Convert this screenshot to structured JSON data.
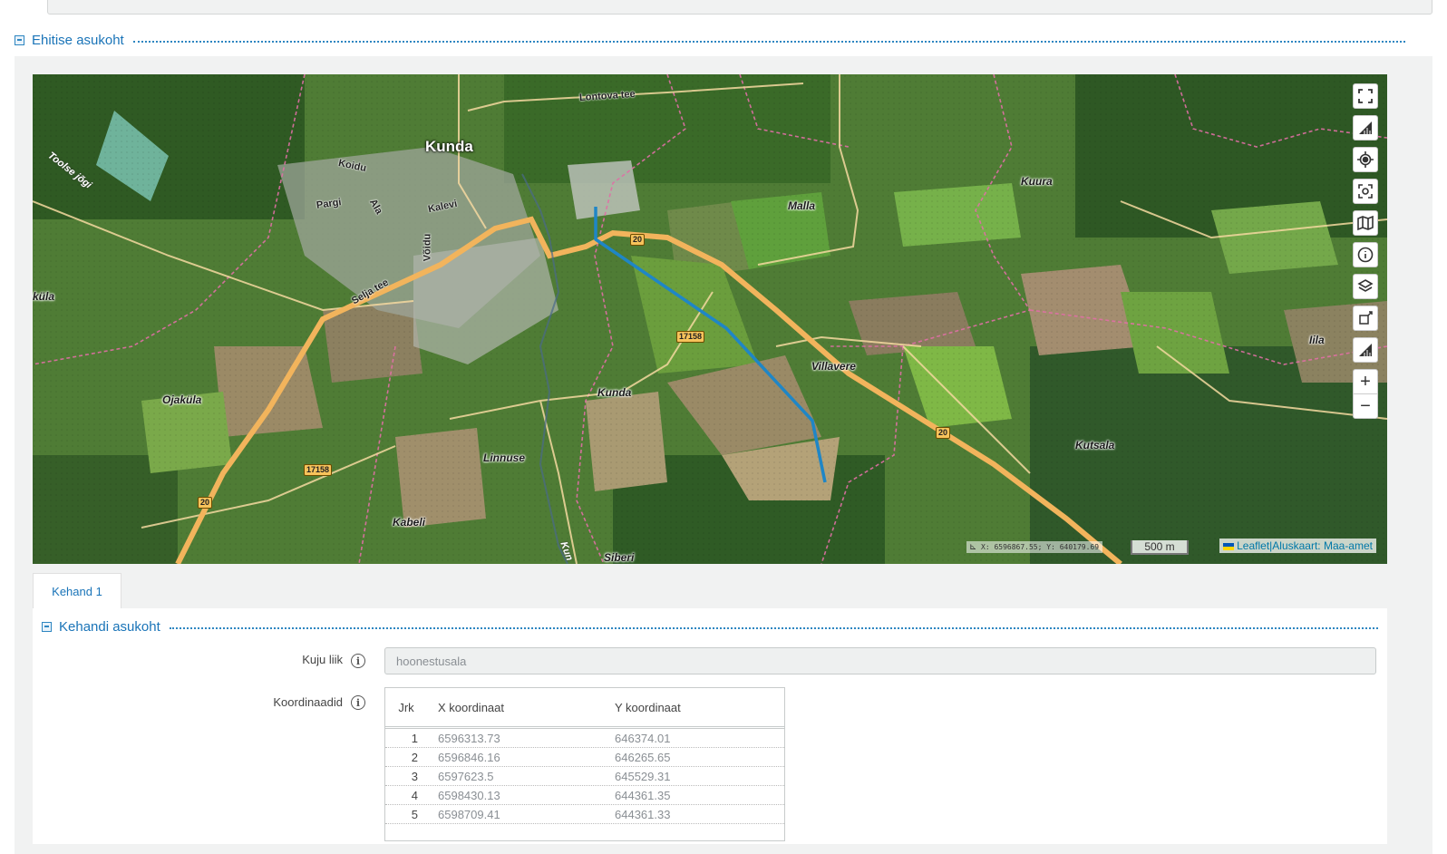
{
  "section": {
    "title": "Ehitise asukoht"
  },
  "map": {
    "places": {
      "kunda_town": "Kunda",
      "koidu": "Koidu",
      "pargi": "Pargi",
      "ala": "Ala",
      "kalevi": "Kalevi",
      "voidu": "Võidu",
      "selja_tee": "Selja tee",
      "lontova_tee": "Lontova tee",
      "toolse_jogi": "Toolse jõgi",
      "kula": "küla",
      "ojakula": "Ojaküla",
      "malla": "Malla",
      "kuura": "Kuura",
      "villavere": "Villavere",
      "kunda_village": "Kunda",
      "linnuse": "Linnuse",
      "kabeli": "Kabeli",
      "siberi": "Siberi",
      "kutsala": "Kutsala",
      "iila": "Iila",
      "kunda_river": "Kun"
    },
    "road_numbers": {
      "r20": "20",
      "r17158": "17158"
    },
    "coordinate_readout": "X: 6596867.55; Y: 640179.69",
    "scale": "500 m",
    "attribution": {
      "leaflet": "Leaflet",
      "separator": "|",
      "basemap": "Aluskaart: Maa-amet"
    },
    "controls": [
      "fullscreen-icon",
      "measure-icon",
      "locate-icon",
      "screenshot-icon",
      "basemap-icon",
      "info-icon",
      "layers-icon",
      "draw-icon",
      "measure-area-icon"
    ],
    "zoom": {
      "in": "+",
      "out": "−"
    },
    "colors": {
      "line": "#1f86c6",
      "main_road": "#f2b45c",
      "boundary": "#e06fa5"
    }
  },
  "tabs": [
    {
      "label": "Kehand 1",
      "active": true
    }
  ],
  "subsection": {
    "title": "Kehandi asukoht"
  },
  "form": {
    "shape_type": {
      "label": "Kuju liik",
      "value": "hoonestusala"
    },
    "coordinates": {
      "label": "Koordinaadid",
      "columns": [
        "Jrk",
        "X koordinaat",
        "Y koordinaat"
      ],
      "rows": [
        {
          "jrk": "1",
          "x": "6596313.73",
          "y": "646374.01"
        },
        {
          "jrk": "2",
          "x": "6596846.16",
          "y": "646265.65"
        },
        {
          "jrk": "3",
          "x": "6597623.5",
          "y": "645529.31"
        },
        {
          "jrk": "4",
          "x": "6598430.13",
          "y": "644361.35"
        },
        {
          "jrk": "5",
          "x": "6598709.41",
          "y": "644361.33"
        }
      ]
    }
  }
}
